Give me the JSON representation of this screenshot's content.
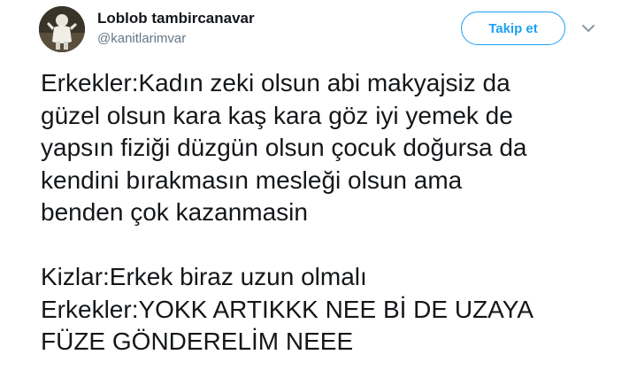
{
  "author": {
    "display_name": "Loblob tambircanavar",
    "handle": "@kanitlarimvar",
    "avatar_icon": "user-avatar-icon"
  },
  "actions": {
    "follow_label": "Takip et",
    "more_icon": "chevron-down-icon"
  },
  "colors": {
    "accent": "#1da1f2",
    "text": "#14171a",
    "secondary_text": "#657786"
  },
  "tweet": {
    "paragraph1": [
      "Erkekler:Kadın zeki olsun abi makyajsiz da",
      "güzel olsun kara kaş kara göz iyi yemek de",
      "yapsın fiziği düzgün olsun çocuk doğursa da",
      "kendini bırakmasın mesleği olsun ama",
      "benden çok kazanmasin"
    ],
    "paragraph2": [
      "Kizlar:Erkek biraz uzun olmalı",
      "Erkekler:YOKK ARTIKKK NEE Bİ DE UZAYA",
      "FÜZE GÖNDERELİM NEEE"
    ]
  }
}
